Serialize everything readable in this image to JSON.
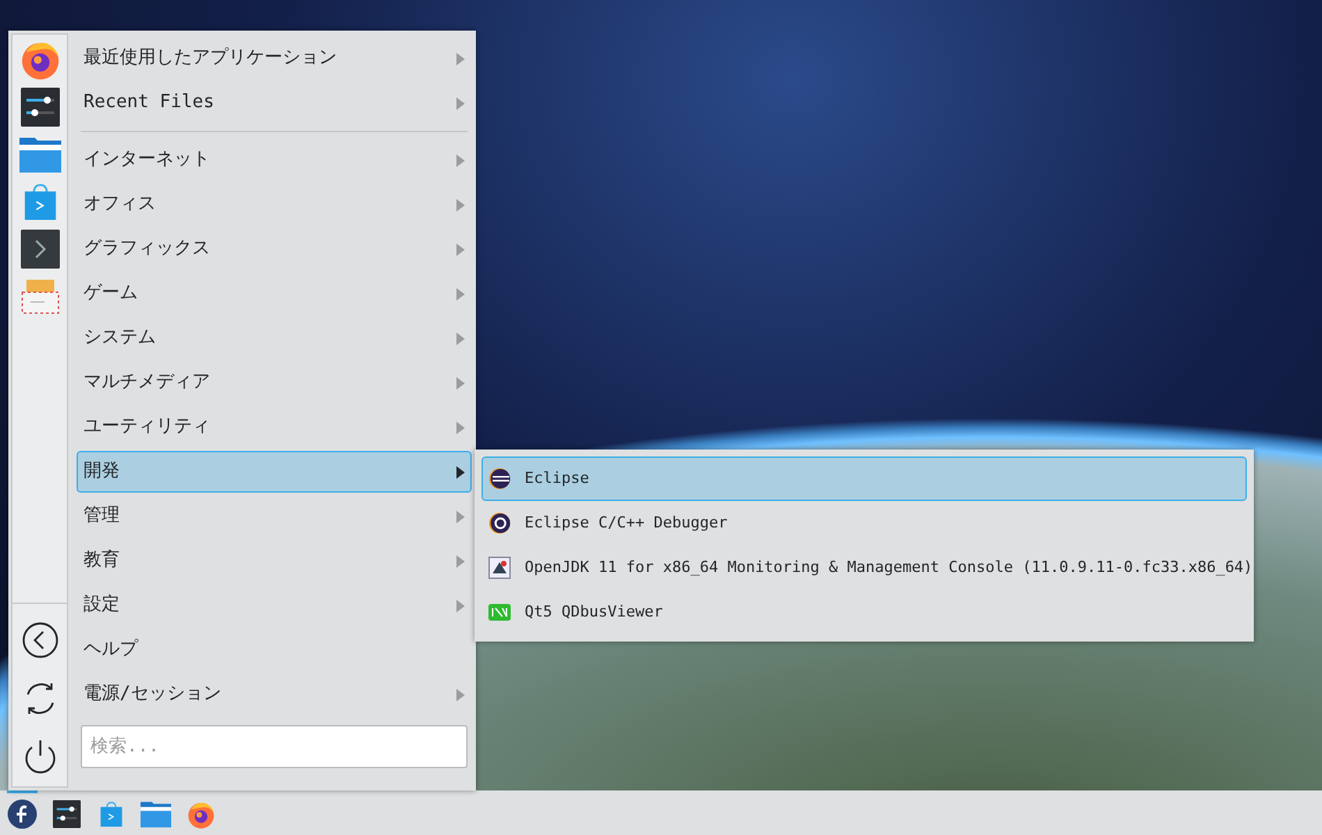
{
  "recent": [
    {
      "label": "最近使用したアプリケーション",
      "has_submenu": true,
      "selected": false
    },
    {
      "label": "Recent Files",
      "has_submenu": true,
      "selected": false
    }
  ],
  "categories": [
    {
      "label": "インターネット",
      "has_submenu": true,
      "selected": false
    },
    {
      "label": "オフィス",
      "has_submenu": true,
      "selected": false
    },
    {
      "label": "グラフィックス",
      "has_submenu": true,
      "selected": false
    },
    {
      "label": "ゲーム",
      "has_submenu": true,
      "selected": false
    },
    {
      "label": "システム",
      "has_submenu": true,
      "selected": false
    },
    {
      "label": "マルチメディア",
      "has_submenu": true,
      "selected": false
    },
    {
      "label": "ユーティリティ",
      "has_submenu": true,
      "selected": false
    },
    {
      "label": "開発",
      "has_submenu": true,
      "selected": true
    },
    {
      "label": "管理",
      "has_submenu": true,
      "selected": false
    },
    {
      "label": "教育",
      "has_submenu": true,
      "selected": false
    },
    {
      "label": "設定",
      "has_submenu": true,
      "selected": false
    },
    {
      "label": "ヘルプ",
      "has_submenu": false,
      "selected": false
    },
    {
      "label": "電源/セッション",
      "has_submenu": true,
      "selected": false
    }
  ],
  "search": {
    "placeholder": "検索..."
  },
  "submenu": [
    {
      "label": "Eclipse",
      "kind": "eclipse",
      "selected": true
    },
    {
      "label": "Eclipse C/C++ Debugger",
      "kind": "cdt",
      "selected": false
    },
    {
      "label": "OpenJDK 11 for x86_64 Monitoring & Management Console (11.0.9.11-0.fc33.x86_64)",
      "kind": "jdk",
      "selected": false
    },
    {
      "label": "Qt5 QDbusViewer",
      "kind": "qt",
      "selected": false
    }
  ],
  "taskbar": {
    "items": [
      {
        "kind": "launcher",
        "selected": true
      },
      {
        "kind": "settings",
        "selected": false
      },
      {
        "kind": "store",
        "selected": false
      },
      {
        "kind": "folder",
        "selected": false
      },
      {
        "kind": "browser",
        "selected": false
      }
    ]
  }
}
